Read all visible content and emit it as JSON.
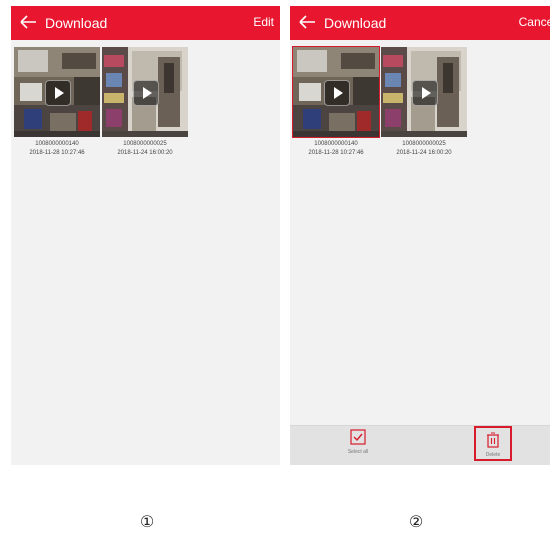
{
  "screens": [
    {
      "title": "Download",
      "action_label": "Edit",
      "videos": [
        {
          "id": "1008000000140",
          "datetime": "2018-11-28 10:27:46"
        },
        {
          "id": "1008000000025",
          "datetime": "2018-11-24 16:00:20"
        }
      ]
    },
    {
      "title": "Download",
      "action_label": "Cancel",
      "videos": [
        {
          "id": "1008000000140",
          "datetime": "2018-11-28 10:27:46",
          "selected": true
        },
        {
          "id": "1008000000025",
          "datetime": "2018-11-24 16:00:20",
          "selected": false
        }
      ],
      "bottom_bar": {
        "select_all_label": "Select all",
        "delete_label": "Delete"
      }
    }
  ],
  "step_labels": [
    "①",
    "②"
  ],
  "colors": {
    "accent": "#e8172f",
    "highlight": "#d91a2c"
  },
  "icons": [
    "back-arrow-icon",
    "play-icon",
    "select-all-checkbox-icon",
    "trash-icon"
  ]
}
